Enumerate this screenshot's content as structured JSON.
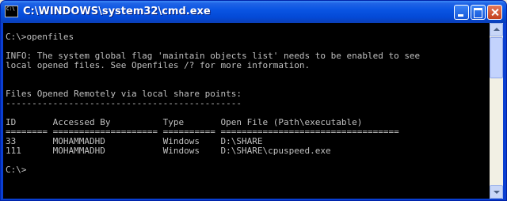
{
  "window": {
    "title": "C:\\WINDOWS\\system32\\cmd.exe",
    "icon": "cmd-icon",
    "icon_text": "C:\\"
  },
  "console": {
    "lines": [
      "C:\\>openfiles",
      "",
      "INFO: The system global flag 'maintain objects list' needs to be enabled to see",
      "local opened files. See Openfiles /? for more information.",
      "",
      "",
      "Files Opened Remotely via local share points:",
      "---------------------------------------------",
      "",
      "ID       Accessed By          Type       Open File (Path\\executable)",
      "======== ==================== ========== ==================================",
      "33       MOHAMMADHD           Windows    D:\\SHARE",
      "111      MOHAMMADHD           Windows    D:\\SHARE\\cpuspeed.exe",
      "",
      "C:\\>"
    ]
  },
  "colors": {
    "title_bar": "#0a55e3",
    "console_bg": "#000000",
    "console_text": "#c0c0c0"
  }
}
